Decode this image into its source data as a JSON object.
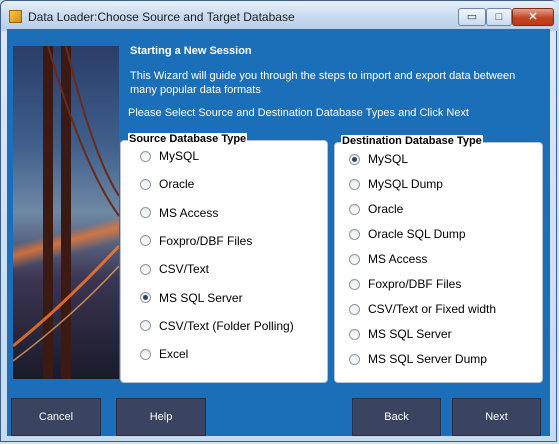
{
  "window": {
    "title": "Data Loader:Choose Source and Target Database",
    "minimize_symbol": "▭",
    "maximize_symbol": "□",
    "close_symbol": "✕"
  },
  "intro": {
    "heading": "Starting a New Session",
    "description": "This Wizard will guide you through the steps to import and export data between many popular data formats",
    "instruction": "Please Select Source and Destination Database Types and Click Next"
  },
  "source": {
    "legend": "Source Database Type",
    "options": [
      "MySQL",
      "Oracle",
      "MS Access",
      "Foxpro/DBF Files",
      "CSV/Text",
      "MS SQL Server",
      "CSV/Text (Folder Polling)",
      "Excel"
    ],
    "selected": "MS SQL Server"
  },
  "destination": {
    "legend": "Destination Database Type",
    "options": [
      "MySQL",
      "MySQL Dump",
      "Oracle",
      "Oracle SQL Dump",
      "MS Access",
      "Foxpro/DBF Files",
      "CSV/Text or Fixed width",
      "MS SQL Server",
      "MS SQL Server Dump"
    ],
    "selected": "MySQL"
  },
  "buttons": {
    "cancel": "Cancel",
    "help": "Help",
    "back": "Back",
    "next": "Next"
  },
  "colors": {
    "panel_background": "#1b6fb9",
    "button_background": "#3a4360"
  }
}
